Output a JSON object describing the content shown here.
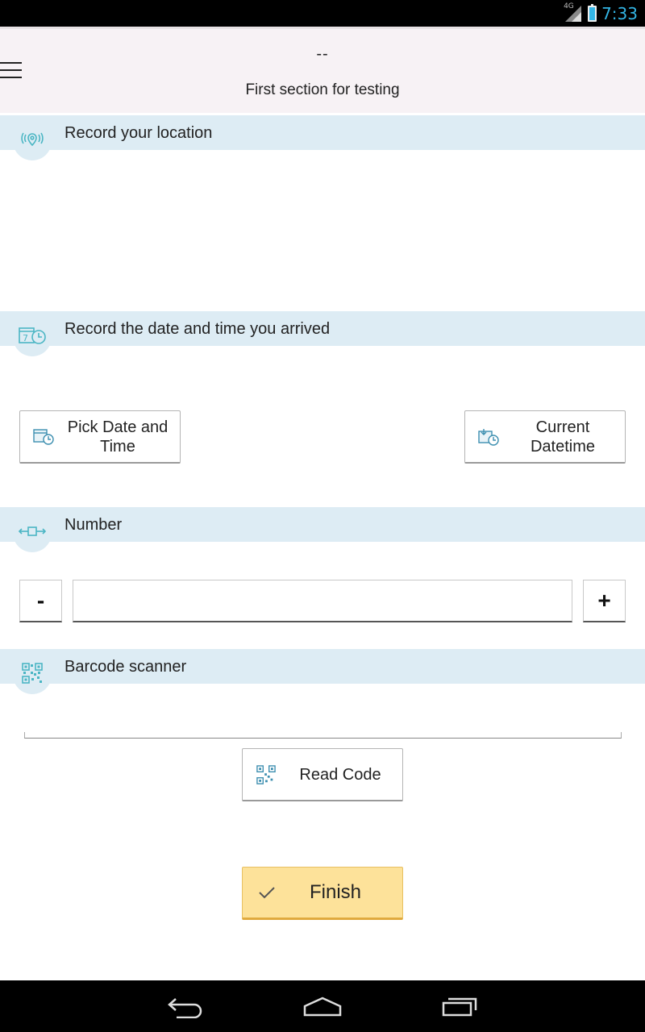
{
  "status_bar": {
    "time": "7:33",
    "network": "4G"
  },
  "header": {
    "dash": "--",
    "title": "First section for testing"
  },
  "sections": {
    "location": {
      "label": "Record your location"
    },
    "datetime": {
      "label": "Record the date and time you arrived"
    },
    "number": {
      "label": "Number"
    },
    "barcode": {
      "label": "Barcode scanner"
    }
  },
  "datetime_buttons": {
    "pick_line1": "Pick Date and",
    "pick_line2": "Time",
    "current_line1": "Current",
    "current_line2": "Datetime"
  },
  "number_field": {
    "minus": "-",
    "plus": "+",
    "value": ""
  },
  "barcode": {
    "read_code_label": "Read Code"
  },
  "finish": {
    "label": "Finish"
  },
  "colors": {
    "section_bg": "#ddecf4",
    "icon_accent": "#4bb6c4",
    "finish_bg": "#fde29a",
    "status_accent": "#33b5e5"
  }
}
